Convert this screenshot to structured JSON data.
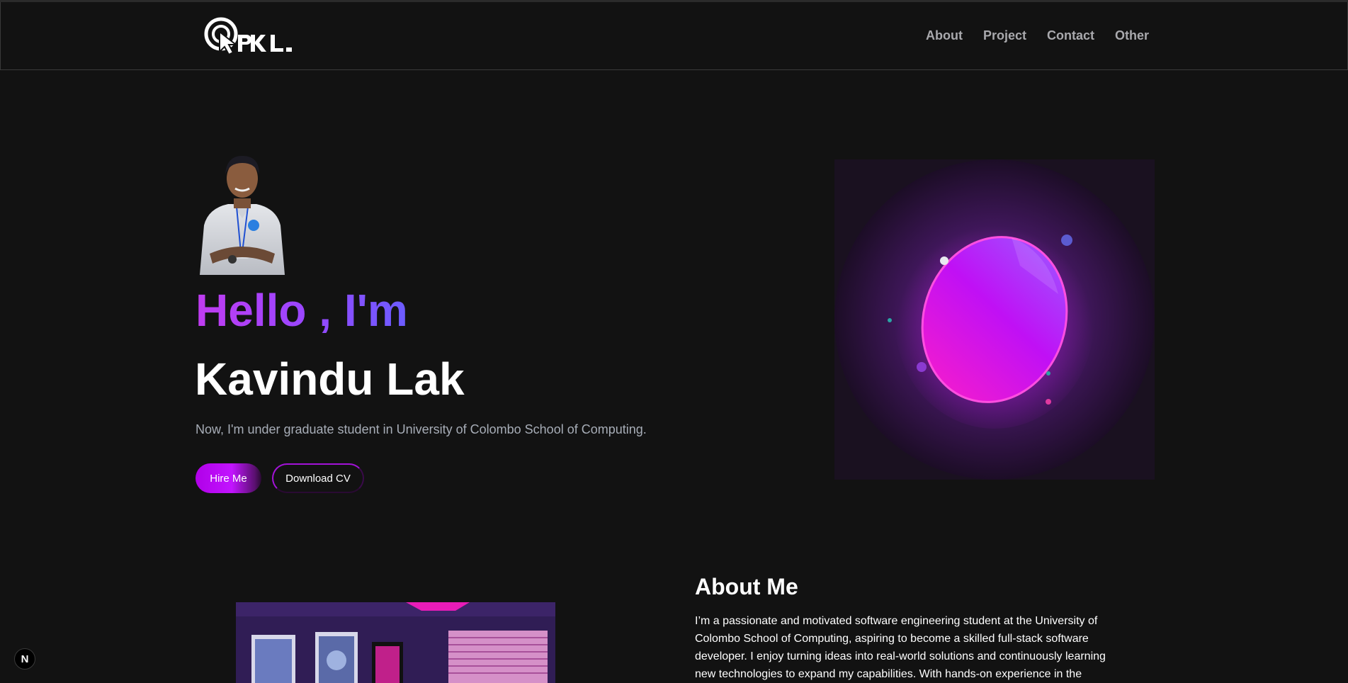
{
  "header": {
    "nav": [
      "About",
      "Project",
      "Contact",
      "Other"
    ]
  },
  "hero": {
    "greeting": "Hello , I'm",
    "name": "Kavindu Lak",
    "subtitle": "Now, I'm under graduate student in University of Colombo School of Computing.",
    "hire_label": "Hire Me",
    "cv_label": "Download CV"
  },
  "about": {
    "title": "About Me",
    "lines": [
      "I’m a passionate and motivated software engineering student at the University of",
      "Colombo School of Computing, aspiring to become a skilled full-stack software",
      "developer. I enjoy turning ideas into real-world solutions and continuously learning",
      "new technologies to expand my capabilities. With hands-on experience in the"
    ]
  },
  "badge": {
    "label": "N"
  },
  "colors": {
    "background": "#121212",
    "accent_purple": "#c214ff",
    "accent_blue": "#6b5cff",
    "muted_text": "#a7adb7"
  },
  "icons": [
    "cursor-logo-icon",
    "next-badge-icon"
  ]
}
